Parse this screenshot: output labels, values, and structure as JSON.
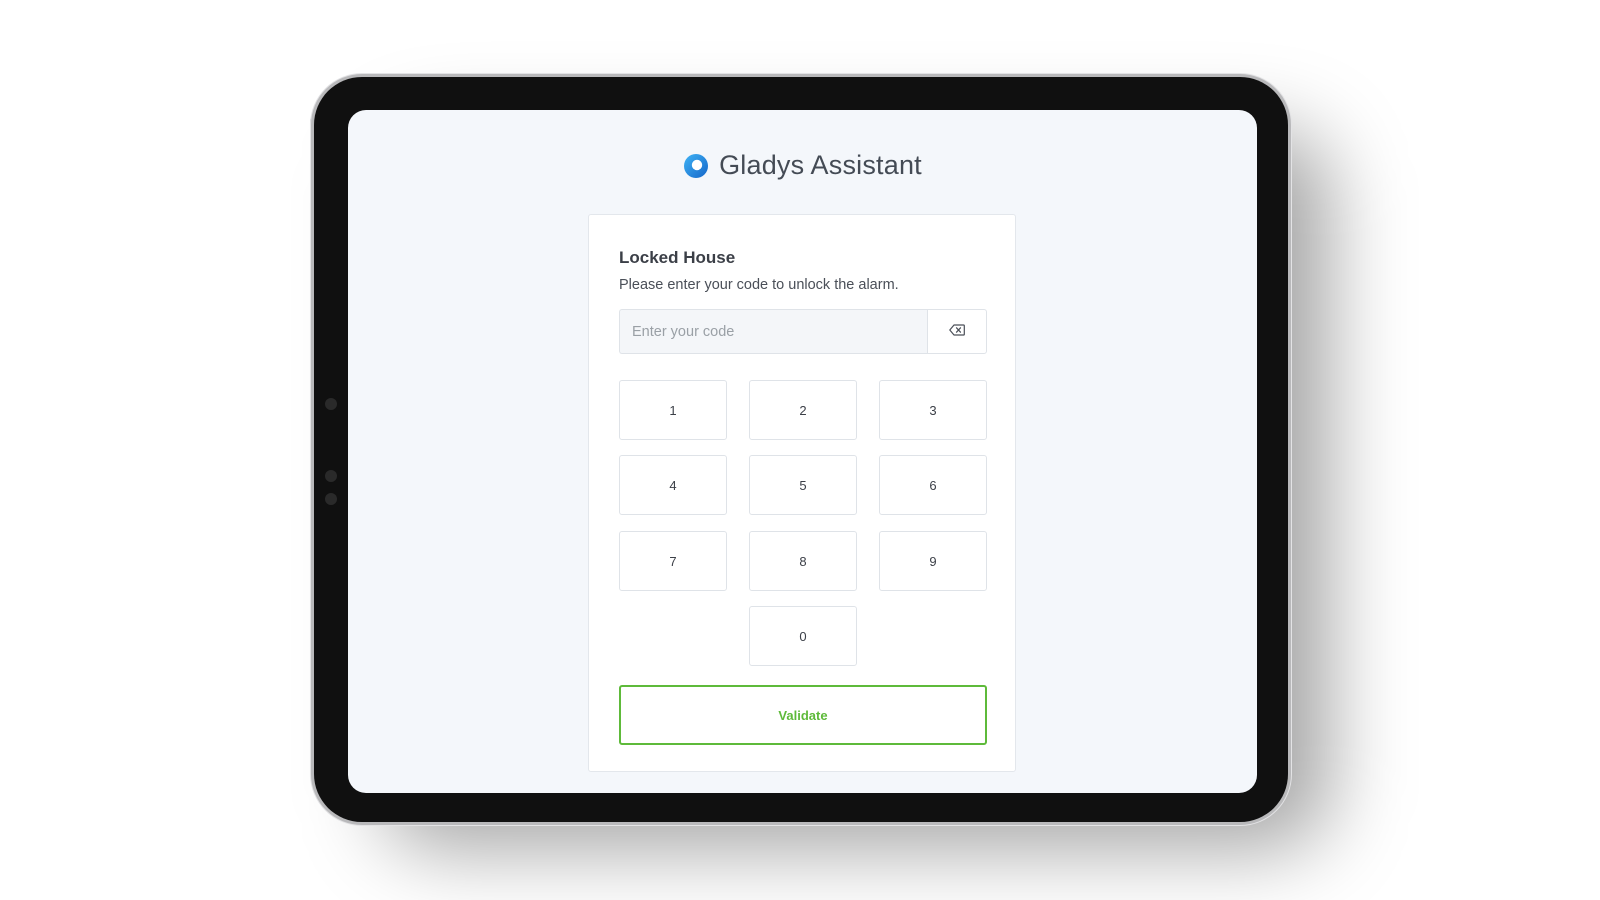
{
  "app": {
    "title": "Gladys Assistant"
  },
  "card": {
    "title": "Locked House",
    "subtitle": "Please enter your code to unlock the alarm."
  },
  "code_input": {
    "placeholder": "Enter your code",
    "value": ""
  },
  "keypad": {
    "keys": [
      "1",
      "2",
      "3",
      "4",
      "5",
      "6",
      "7",
      "8",
      "9",
      "0"
    ]
  },
  "validate": {
    "label": "Validate"
  },
  "icons": {
    "logo": "gladys-logo-icon",
    "backspace": "backspace-icon"
  },
  "colors": {
    "accent_green": "#5eba3a",
    "logo_blue": "#1e8be0",
    "screen_bg": "#f4f7fb"
  }
}
